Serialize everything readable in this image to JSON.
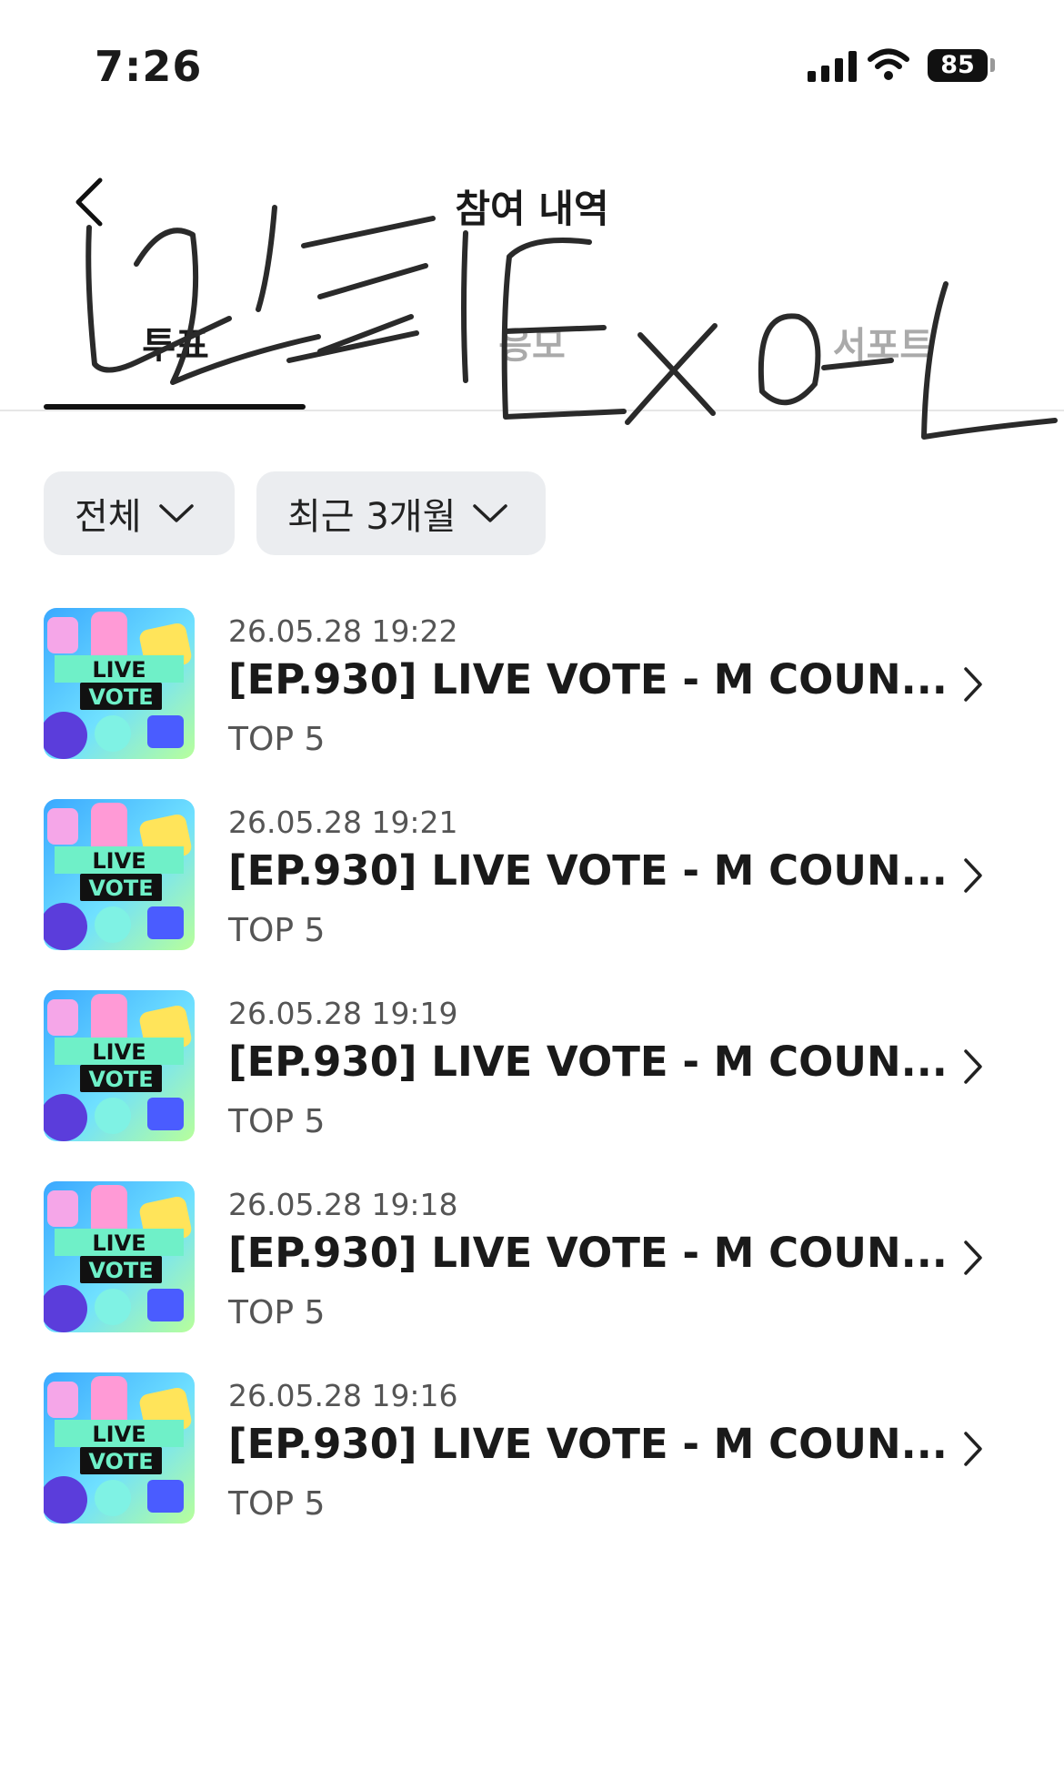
{
  "status_bar": {
    "time": "7:26",
    "battery": "85"
  },
  "header": {
    "title": "참여 내역"
  },
  "tabs": [
    {
      "label": "투표",
      "active": true
    },
    {
      "label": "응모",
      "active": false
    },
    {
      "label": "서포트",
      "active": false
    }
  ],
  "filters": [
    {
      "label": "전체"
    },
    {
      "label": "최근 3개월"
    }
  ],
  "thumbnail": {
    "line1": "LIVE",
    "line2": "VOTE"
  },
  "items": [
    {
      "date": "26.05.28 19:22",
      "title": "[EP.930] LIVE VOTE - M COUN...",
      "subtitle": "TOP 5"
    },
    {
      "date": "26.05.28 19:21",
      "title": "[EP.930] LIVE VOTE - M COUN...",
      "subtitle": "TOP 5"
    },
    {
      "date": "26.05.28 19:19",
      "title": "[EP.930] LIVE VOTE - M COUN...",
      "subtitle": "TOP 5"
    },
    {
      "date": "26.05.28 19:18",
      "title": "[EP.930] LIVE VOTE - M COUN...",
      "subtitle": "TOP 5"
    },
    {
      "date": "26.05.28 19:16",
      "title": "[EP.930] LIVE VOTE - M COUN...",
      "subtitle": "TOP 5"
    }
  ],
  "colors": {
    "accent": "#111111",
    "inactive_tab": "#aaaaaa",
    "filter_bg": "#ebedf0",
    "thumb_banner": "#6ff0c8"
  }
}
